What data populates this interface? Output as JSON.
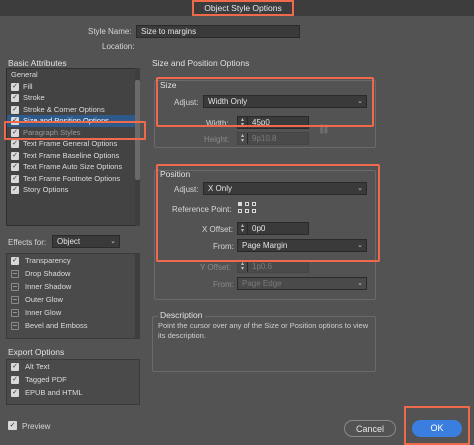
{
  "window": {
    "title": "Object Style Options"
  },
  "style_name": {
    "label": "Style Name:",
    "value": "Size to margins"
  },
  "location": {
    "label": "Location:"
  },
  "basic_attributes": {
    "title": "Basic Attributes",
    "items": [
      {
        "label": "General",
        "checked": null
      },
      {
        "label": "Fill",
        "checked": true
      },
      {
        "label": "Stroke",
        "checked": true
      },
      {
        "label": "Stroke & Corner Options",
        "checked": true
      },
      {
        "label": "Size and Position Options",
        "checked": true,
        "selected": true
      },
      {
        "label": "Paragraph Styles",
        "checked": true
      },
      {
        "label": "Text Frame General Options",
        "checked": true
      },
      {
        "label": "Text Frame Baseline Options",
        "checked": true
      },
      {
        "label": "Text Frame Auto Size Options",
        "checked": true
      },
      {
        "label": "Text Frame Footnote Options",
        "checked": true
      },
      {
        "label": "Story Options",
        "checked": true
      }
    ]
  },
  "effects_for": {
    "label": "Effects for:",
    "value": "Object"
  },
  "effects": [
    {
      "label": "Transparency",
      "checked": true
    },
    {
      "label": "Drop Shadow",
      "checked": false
    },
    {
      "label": "Inner Shadow",
      "checked": false
    },
    {
      "label": "Outer Glow",
      "checked": false
    },
    {
      "label": "Inner Glow",
      "checked": false
    },
    {
      "label": "Bevel and Emboss",
      "checked": false
    }
  ],
  "export_options": {
    "title": "Export Options",
    "items": [
      {
        "label": "Alt Text",
        "checked": true
      },
      {
        "label": "Tagged PDF",
        "checked": true
      },
      {
        "label": "EPUB and HTML",
        "checked": true
      }
    ]
  },
  "size_position": {
    "title": "Size and Position Options",
    "size": {
      "title": "Size",
      "adjust_label": "Adjust:",
      "adjust_value": "Width Only",
      "width_label": "Width:",
      "width_value": "45p0",
      "height_label": "Height:",
      "height_value": "9p10.8"
    },
    "position": {
      "title": "Position",
      "adjust_label": "Adjust:",
      "adjust_value": "X Only",
      "reference_label": "Reference Point:",
      "x_offset_label": "X Offset:",
      "x_offset_value": "0p0",
      "from_label": "From:",
      "from_value": "Page Margin",
      "y_offset_label": "Y Offset:",
      "y_offset_value": "1p0.6",
      "y_from_label": "From:",
      "y_from_value": "Page Edge"
    }
  },
  "description": {
    "title": "Description",
    "text": "Point the cursor over any of the Size or Position options to view its description."
  },
  "preview": {
    "label": "Preview",
    "checked": true
  },
  "buttons": {
    "cancel": "Cancel",
    "ok": "OK"
  }
}
